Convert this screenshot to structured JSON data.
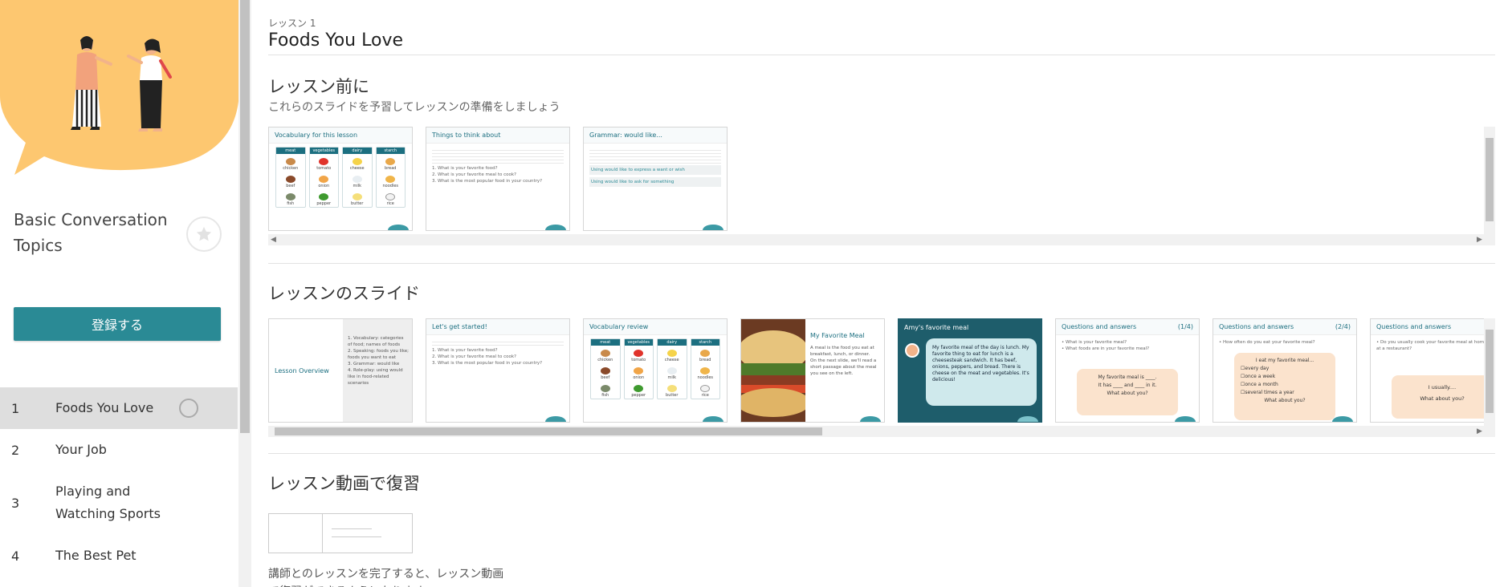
{
  "sidebar": {
    "course_title": "Basic Conversation Topics",
    "register_label": "登録する",
    "lessons": [
      {
        "num": "1",
        "name": "Foods You Love"
      },
      {
        "num": "2",
        "name": "Your Job"
      },
      {
        "num": "3",
        "name": "Playing and Watching Sports"
      },
      {
        "num": "4",
        "name": "The Best Pet"
      }
    ]
  },
  "main": {
    "breadcrumb": "レッスン 1",
    "title": "Foods You Love",
    "before_lesson": {
      "title": "レッスン前に",
      "subtitle": "これらのスライドを予習してレッスンの準備をしましょう",
      "slides": [
        {
          "head": "Vocabulary for this lesson"
        },
        {
          "head": "Things to think about",
          "lines": [
            "1. What is your favorite food?",
            "2. What is your favorite meal to cook?",
            "3. What is the most popular food in your country?"
          ]
        },
        {
          "head": "Grammar: would like...",
          "lines": [
            "Using would like to express a want or wish",
            "Using would like to ask for something"
          ]
        }
      ]
    },
    "lesson_slides": {
      "title": "レッスンのスライド",
      "slides": [
        {
          "head": "Lesson Overview",
          "lines": [
            "1. Vocabulary: categories of food; names of foods",
            "2. Speaking: foods you like; foods you want to eat",
            "3. Grammar: would like",
            "4. Role-play: using would like in food-related scenarios"
          ]
        },
        {
          "head": "Let's get started!",
          "lines": [
            "1. What is your favorite food?",
            "2. What is your favorite meal to cook?",
            "3. What is the most popular food in your country?"
          ]
        },
        {
          "head": "Vocabulary review"
        },
        {
          "head": "My Favorite Meal",
          "lines": [
            "A meal is the food you eat at breakfast, lunch, or dinner.",
            "On the next slide, we'll read a short passage about the meal you see on the left."
          ]
        },
        {
          "head": "Amy's favorite meal",
          "lines": [
            "My favorite meal of the day is lunch. My favorite thing to eat for lunch is a cheesesteak sandwich. It has beef, onions, peppers, and bread. There is cheese on the meat and vegetables. It's delicious!"
          ]
        },
        {
          "head": "Questions and answers",
          "page": "(1/4)",
          "lines": [
            "• What is your favorite meal?",
            "• What foods are in your favorite meal?"
          ],
          "bubble": [
            "My favorite meal is ____.",
            "It has ____ and ____ in it.",
            "What about you?"
          ]
        },
        {
          "head": "Questions and answers",
          "page": "(2/4)",
          "lines": [
            "• How often do you eat your favorite meal?"
          ],
          "bubble": [
            "I eat my favorite meal...",
            "☐every day",
            "☐once a week",
            "☐once a month",
            "☐several times a year",
            "What about you?"
          ]
        },
        {
          "head": "Questions and answers",
          "lines": [
            "• Do you usually cook your favorite meal at home or eat it at a restaurant?"
          ],
          "bubble": [
            "I usually....",
            "What about you?"
          ]
        }
      ]
    },
    "video_review": {
      "title": "レッスン動画で復習",
      "note": "講師とのレッスンを完了すると、レッスン動画で復習ができるようになります。"
    }
  },
  "vocab": {
    "columns": [
      "meat",
      "vegetables",
      "dairy",
      "starch"
    ],
    "rows": [
      [
        "chicken",
        "tomato",
        "cheese",
        "bread"
      ],
      [
        "beef",
        "onion",
        "milk",
        "noodles"
      ],
      [
        "fish",
        "pepper",
        "butter",
        "rice"
      ]
    ]
  },
  "colors": {
    "accent": "#2a8a95",
    "hero_bg": "#fdc770",
    "teal_dark": "#1c6f80",
    "active_row": "#dedede"
  }
}
